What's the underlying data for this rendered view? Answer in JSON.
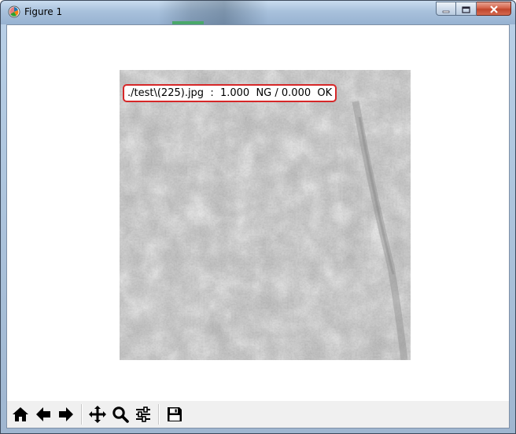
{
  "window": {
    "title": "Figure 1",
    "app_icon": "matplotlib-icon",
    "caption_buttons": [
      {
        "name": "minimize",
        "icon": "minimize-icon"
      },
      {
        "name": "maximize",
        "icon": "maximize-icon"
      },
      {
        "name": "close",
        "icon": "close-icon"
      }
    ]
  },
  "figure": {
    "image_description_kind": "grayscale texture image",
    "annotation": "./test\\(225).jpg  :  1.000  NG / 0.000  OK",
    "annotation_border_color": "#d62728"
  },
  "toolbar": {
    "buttons": [
      {
        "name": "home",
        "icon": "home-icon"
      },
      {
        "name": "back",
        "icon": "arrow-left-icon"
      },
      {
        "name": "forward",
        "icon": "arrow-right-icon"
      },
      {
        "name": "pan",
        "icon": "move-icon"
      },
      {
        "name": "zoom",
        "icon": "magnifier-icon"
      },
      {
        "name": "configure-subplots",
        "icon": "sliders-icon"
      },
      {
        "name": "save",
        "icon": "floppy-disk-icon"
      }
    ]
  }
}
